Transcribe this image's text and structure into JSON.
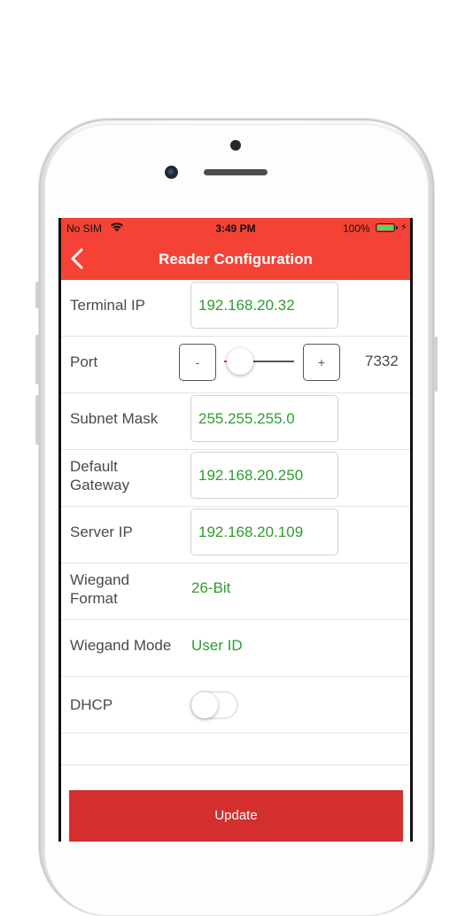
{
  "status_bar": {
    "carrier": "No SIM",
    "time": "3:49 PM",
    "battery": "100%"
  },
  "header": {
    "title": "Reader Configuration",
    "back_icon": "chevron-left-icon"
  },
  "form": {
    "terminal_ip": {
      "label": "Terminal IP",
      "value": "192.168.20.32"
    },
    "port": {
      "label": "Port",
      "minus": "-",
      "plus": "+",
      "value": "7332",
      "slider_fraction": 0.0
    },
    "subnet_mask": {
      "label": "Subnet Mask",
      "value": "255.255.255.0"
    },
    "default_gateway": {
      "label_line1": "Default",
      "label_line2": "Gateway",
      "value": "192.168.20.250"
    },
    "server_ip": {
      "label": "Server IP",
      "value": "192.168.20.109"
    },
    "wiegand_format": {
      "label_line1": "Wiegand",
      "label_line2": "Format",
      "value": "26-Bit"
    },
    "wiegand_mode": {
      "label": "Wiegand Mode",
      "value": "User ID"
    },
    "dhcp": {
      "label": "DHCP",
      "enabled": false
    }
  },
  "actions": {
    "update_label": "Update"
  },
  "colors": {
    "header": "#f44336",
    "value_text": "#2e9d2e",
    "update_button": "#d32f2f"
  }
}
